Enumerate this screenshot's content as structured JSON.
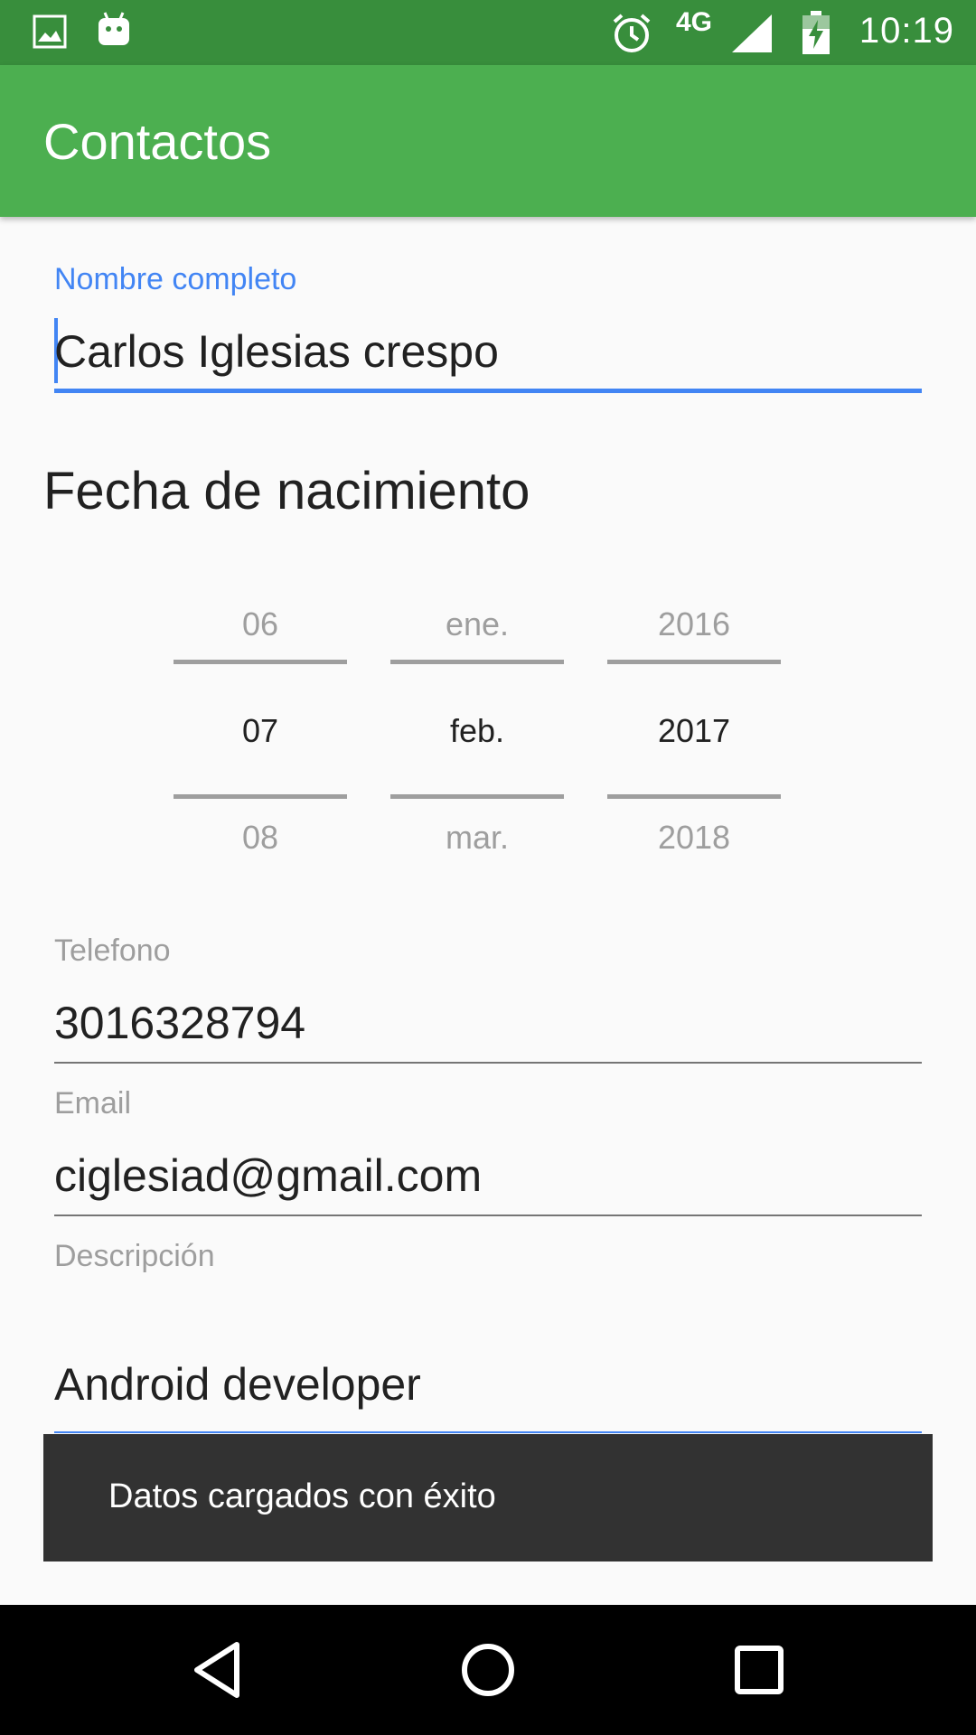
{
  "status_bar": {
    "time": "10:19",
    "network": "4G",
    "icons": [
      "image-icon",
      "android-icon",
      "alarm-icon",
      "signal-icon",
      "battery-charging-icon"
    ]
  },
  "app_bar": {
    "title": "Contactos"
  },
  "form": {
    "name": {
      "label": "Nombre completo",
      "value": "Carlos Iglesias crespo"
    },
    "birth_section_title": "Fecha de nacimiento",
    "date_picker": {
      "day": {
        "prev": "06",
        "selected": "07",
        "next": "08"
      },
      "month": {
        "prev": "ene.",
        "selected": "feb.",
        "next": "mar."
      },
      "year": {
        "prev": "2016",
        "selected": "2017",
        "next": "2018"
      }
    },
    "phone": {
      "label": "Telefono",
      "value": "3016328794"
    },
    "email": {
      "label": "Email",
      "value": "ciglesiad@gmail.com"
    },
    "description": {
      "label": "Descripción",
      "value": "Android developer"
    }
  },
  "snackbar": {
    "message": "Datos cargados con éxito"
  },
  "nav_bar": {
    "icons": [
      "back-icon",
      "home-icon",
      "recents-icon"
    ]
  },
  "colors": {
    "status_bar": "#388e3c",
    "app_bar": "#4caf50",
    "accent": "#4285f4",
    "snackbar": "#323232"
  }
}
